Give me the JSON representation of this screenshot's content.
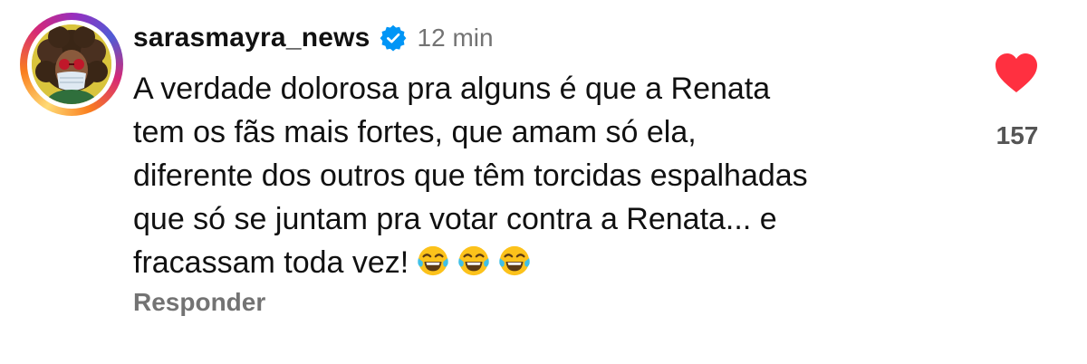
{
  "comment": {
    "username": "sarasmayra_news",
    "verified": true,
    "timestamp": "12 min",
    "text_lines": [
      "A verdade dolorosa pra alguns é que a Renata",
      "tem os fãs mais fortes, que amam só ela,",
      "diferente dos outros que têm torcidas espalhadas",
      "que só se juntam pra votar contra a Renata... e",
      "fracassam toda vez!"
    ],
    "emojis": [
      "face-with-tears-of-joy",
      "face-with-tears-of-joy",
      "face-with-tears-of-joy"
    ],
    "reply_label": "Responder",
    "likes": "157",
    "liked": true
  },
  "colors": {
    "like_red": "#ff3040",
    "verified_blue": "#0095f6",
    "secondary_text": "#737373",
    "primary_text": "#111111"
  }
}
